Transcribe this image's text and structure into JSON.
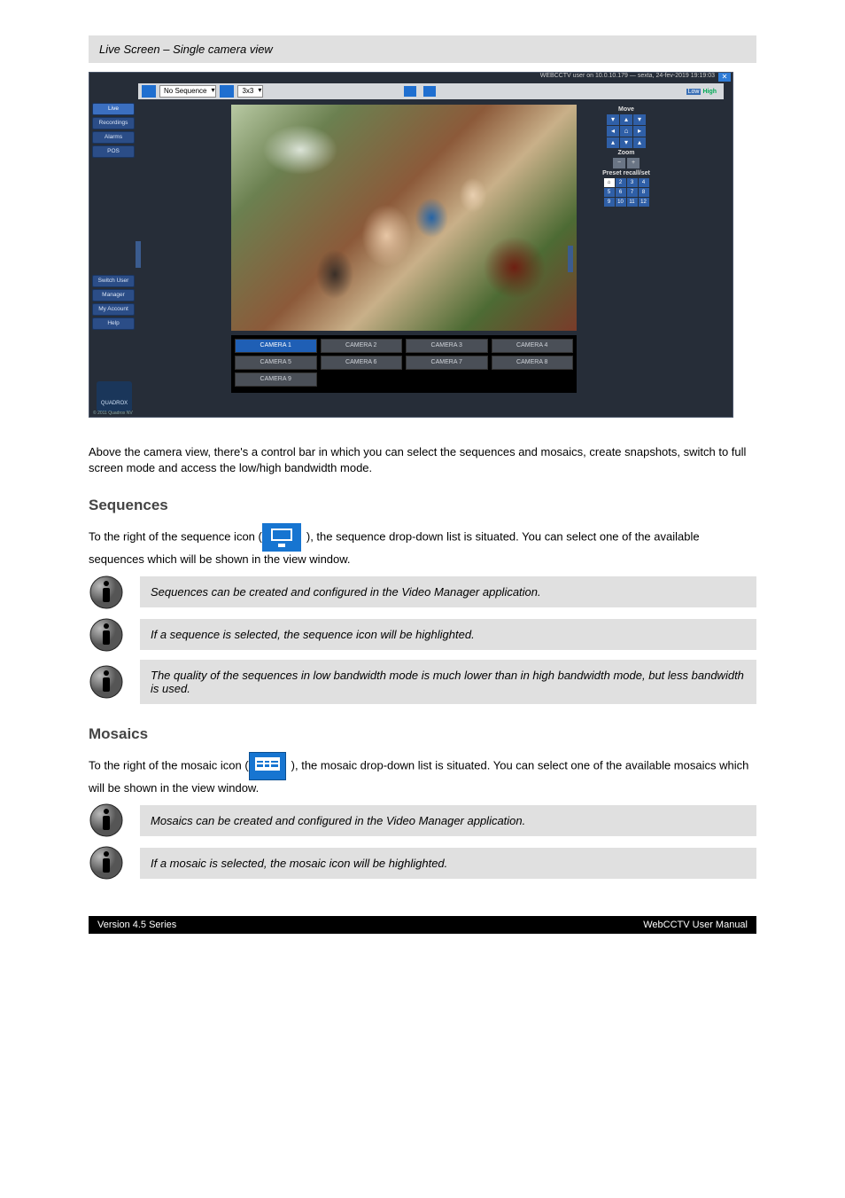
{
  "caption": "Live Screen – Single camera view",
  "screenshot": {
    "titlebar_text": "WEBCCTV user on 10.0.10.179 — sexta, 24-fev-2019 19:19:03",
    "toolbar": {
      "sequence_select": "No Sequence",
      "mosaic_select": "3x3",
      "low_label": "Low",
      "high_label": "High"
    },
    "left_nav": [
      "Live",
      "Recordings",
      "Alarms",
      "POS"
    ],
    "left_nav2": [
      "Switch User",
      "Manager",
      "My Account",
      "Help"
    ],
    "logo_text": "QUADROX",
    "copyright": "© 2011 Quadrox NV",
    "cameras": [
      "CAMERA 1",
      "CAMERA 2",
      "CAMERA 3",
      "CAMERA 4",
      "CAMERA 5",
      "CAMERA 6",
      "CAMERA 7",
      "CAMERA 8",
      "CAMERA 9"
    ],
    "ptz": {
      "move_label": "Move",
      "zoom_label": "Zoom",
      "preset_label": "Preset recall/set",
      "presets": [
        "⌂",
        "2",
        "3",
        "4",
        "5",
        "6",
        "7",
        "8",
        "9",
        "10",
        "11",
        "12"
      ]
    }
  },
  "body": {
    "para1": "Above the camera view, there's a control bar in which you can select the sequences and mosaics, create snapshots, switch to full screen mode and access the low/high bandwidth mode.",
    "sequences_title": "Sequences",
    "seq_para": "To the right of the sequence icon (            ), the sequence  drop-down list is situated. You can select one of the available sequences which will be shown in the view window.",
    "seq_icon_after": "",
    "note_seq1": "Sequences can be created and configured in the Video Manager application.",
    "note_seq2": "If a sequence is selected, the sequence icon will be highlighted.",
    "note_seq3": "The quality of the sequences in low bandwidth mode is much lower than in high bandwidth mode, but less bandwidth is used.",
    "mosaics_title": "Mosaics",
    "mosaic_para_prefix": "To the right of the mosaic icon (",
    "mosaic_para_suffix": "), the mosaic drop-down list is situated. You can select one of the available mosaics which will be shown in the view window.",
    "note_m1": "Mosaics can be created and configured in the Video Manager application.",
    "note_m2": "If a mosaic is selected, the mosaic icon will be highlighted."
  },
  "footer": {
    "left": "Version 4.5 Series",
    "right": "WebCCTV User Manual"
  }
}
